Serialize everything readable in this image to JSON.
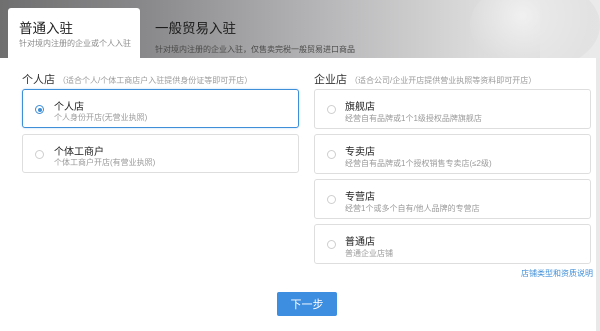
{
  "tabs": {
    "active": {
      "title": "普通入驻",
      "subtitle": "针对境内注册的企业或个人入驻"
    },
    "other": {
      "title": "一般贸易入驻",
      "subtitle": "针对境内注册的企业入驻，仅售卖完税一般贸易进口商品"
    }
  },
  "personal": {
    "title": "个人店",
    "hint": "（适合个人/个体工商店户入驻提供身份证等即可开店）",
    "options": [
      {
        "name": "个人店",
        "desc": "个人身份开店(无营业执照)",
        "selected": true
      },
      {
        "name": "个体工商户",
        "desc": "个体工商户开店(有营业执照)",
        "selected": false
      }
    ]
  },
  "enterprise": {
    "title": "企业店",
    "hint": "（适合公司/企业开店提供营业执照等资料即可开店）",
    "options": [
      {
        "name": "旗舰店",
        "desc": "经营自有品牌或1个1级授权品牌旗舰店",
        "selected": false
      },
      {
        "name": "专卖店",
        "desc": "经营自有品牌或1个授权销售专卖店(≤2级)",
        "selected": false
      },
      {
        "name": "专营店",
        "desc": "经营1个或多个自有/他人品牌的专营店",
        "selected": false
      },
      {
        "name": "普通店",
        "desc": "普通企业店铺",
        "selected": false
      }
    ]
  },
  "help_link": "店铺类型和资质说明",
  "next_button": "下一步",
  "colors": {
    "accent": "#3d8ee0",
    "selected_border": "#3f8fd8"
  }
}
